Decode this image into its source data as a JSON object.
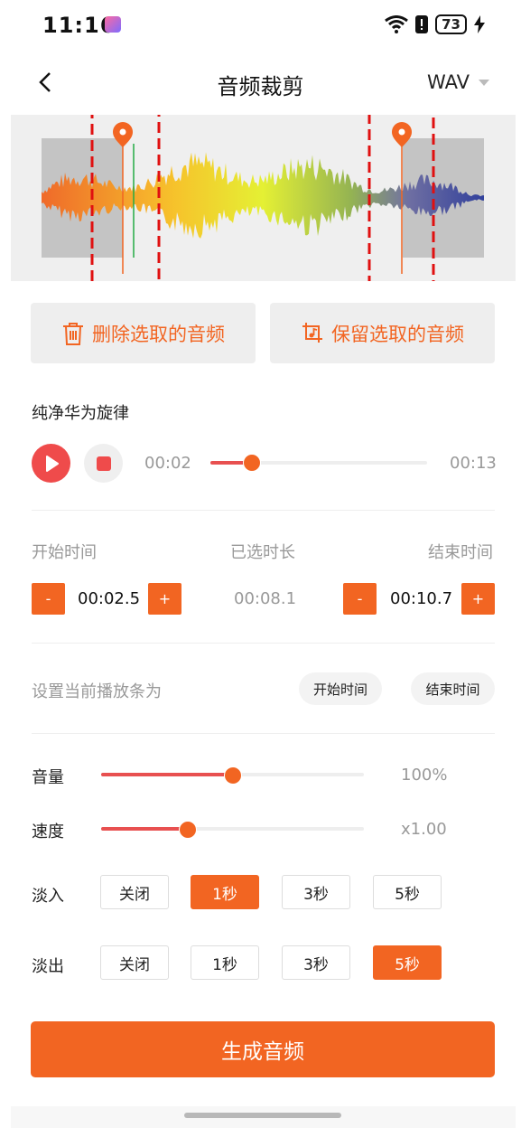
{
  "status_bar": {
    "time": "11:16",
    "battery": "73"
  },
  "header": {
    "title": "音频裁剪",
    "format": "WAV"
  },
  "actions": {
    "delete_label": "删除选取的音频",
    "keep_label": "保留选取的音频"
  },
  "player": {
    "song_title": "纯净华为旋律",
    "current_time": "00:02",
    "total_time": "00:13",
    "progress": 0.19
  },
  "selection": {
    "start_label": "开始时间",
    "duration_label": "已选时长",
    "end_label": "结束时间",
    "start_value": "00:02.5",
    "duration_value": "00:08.1",
    "end_value": "00:10.7",
    "minus": "-",
    "plus": "+"
  },
  "set_playbar": {
    "label": "设置当前播放条为",
    "start_button": "开始时间",
    "end_button": "结束时间"
  },
  "volume": {
    "label": "音量",
    "value": "100%",
    "level": 0.5
  },
  "speed": {
    "label": "速度",
    "value": "x1.00",
    "level": 0.33
  },
  "fade_in": {
    "label": "淡入",
    "options": [
      "关闭",
      "1秒",
      "3秒",
      "5秒"
    ],
    "selected": "1秒"
  },
  "fade_out": {
    "label": "淡出",
    "options": [
      "关闭",
      "1秒",
      "3秒",
      "5秒"
    ],
    "selected": "5秒"
  },
  "generate_label": "生成音频",
  "colors": {
    "accent": "#f26522",
    "slider": "#e85050",
    "play": "#ef4b4b",
    "playhead": "#22aa44"
  },
  "icons": {
    "back": "chevron-left-icon",
    "delete": "trash-icon",
    "keep": "crop-icon",
    "play": "play-icon",
    "stop": "stop-icon"
  }
}
